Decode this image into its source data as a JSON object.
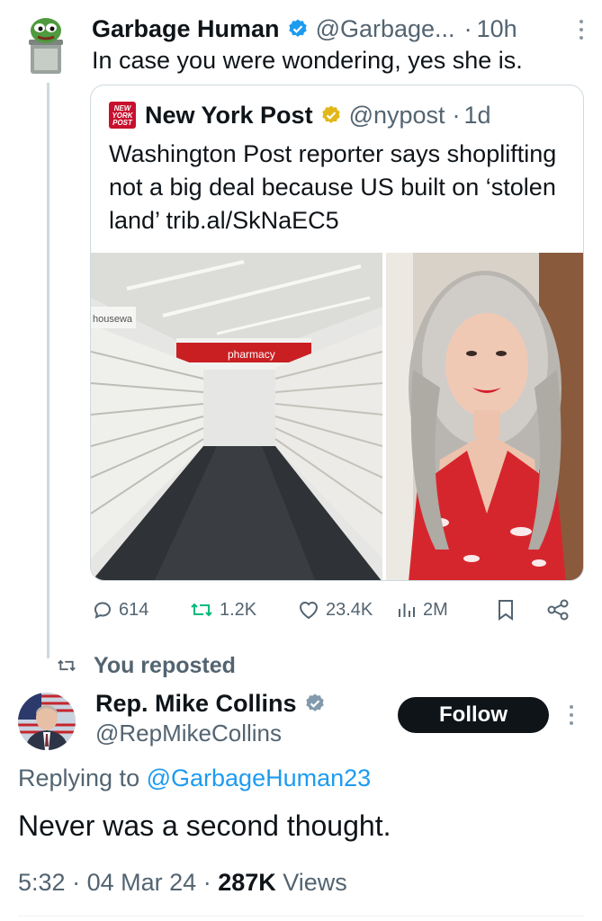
{
  "tweet1": {
    "author_name": "Garbage Human",
    "handle": "@Garbage...",
    "time": "10h",
    "text": "In case you were wondering, yes she is."
  },
  "quote": {
    "author_name": "New York Post",
    "handle": "@nypost",
    "time": "1d",
    "logo_text": "NEW YORK POST",
    "text": "Washington Post reporter says shoplifting not a big deal because US built on ‘stolen land’ trib.al/SkNaEC5",
    "store_sign": "pharmacy",
    "store_sign_left": "housewa"
  },
  "actions": {
    "replies": "614",
    "reposts": "1.2K",
    "likes": "23.4K",
    "views": "2M"
  },
  "repost_label": "You reposted",
  "tweet2": {
    "author_name": "Rep. Mike Collins",
    "handle": "@RepMikeCollins",
    "follow_label": "Follow",
    "replying_prefix": "Replying to",
    "replying_to": "@GarbageHuman23",
    "text": "Never was a second thought.",
    "time": "5:32",
    "date": "04 Mar 24",
    "views_count": "287K",
    "views_label": "Views"
  },
  "colors": {
    "accent": "#1d9bf0",
    "secondary_text": "#536471",
    "verified_gold": "#e2b719",
    "nypost_red": "#c8102e"
  },
  "icons": [
    "verified-icon",
    "more-icon",
    "reply-icon",
    "repost-icon",
    "like-icon",
    "views-icon",
    "bookmark-icon",
    "share-icon"
  ]
}
